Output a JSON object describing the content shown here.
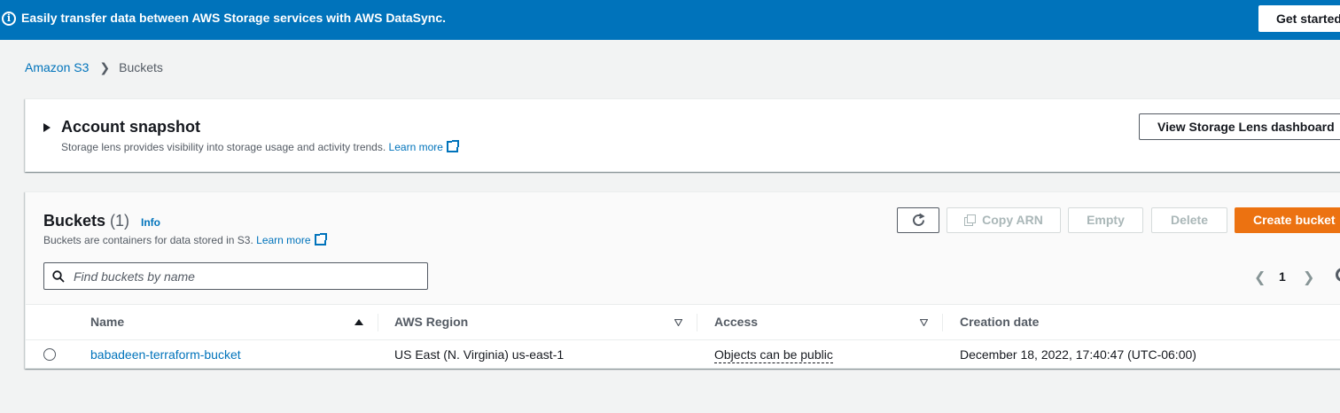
{
  "banner": {
    "message": "Easily transfer data between AWS Storage services with AWS DataSync.",
    "cta_label": "Get started",
    "info_icon": "info-circle-icon",
    "background": "#0073bb"
  },
  "breadcrumb": {
    "items": [
      "Amazon S3",
      "Buckets"
    ]
  },
  "snapshot": {
    "title": "Account snapshot",
    "description": "Storage lens provides visibility into storage usage and activity trends.",
    "learn_more": "Learn more",
    "dashboard_button": "View Storage Lens dashboard"
  },
  "buckets": {
    "title": "Buckets",
    "count": "(1)",
    "info_label": "Info",
    "description": "Buckets are containers for data stored in S3.",
    "learn_more": "Learn more",
    "actions": {
      "copy_arn": "Copy ARN",
      "empty": "Empty",
      "delete": "Delete",
      "create": "Create bucket"
    },
    "search_placeholder": "Find buckets by name",
    "pagination": {
      "current_page": "1"
    },
    "columns": [
      "Name",
      "AWS Region",
      "Access",
      "Creation date"
    ],
    "rows": [
      {
        "name": "babadeen-terraform-bucket",
        "region": "US East (N. Virginia) us-east-1",
        "access": "Objects can be public",
        "created": "December 18, 2022, 17:40:47 (UTC-06:00)"
      }
    ]
  },
  "colors": {
    "primary_action": "#ec7211",
    "link": "#0073bb"
  }
}
